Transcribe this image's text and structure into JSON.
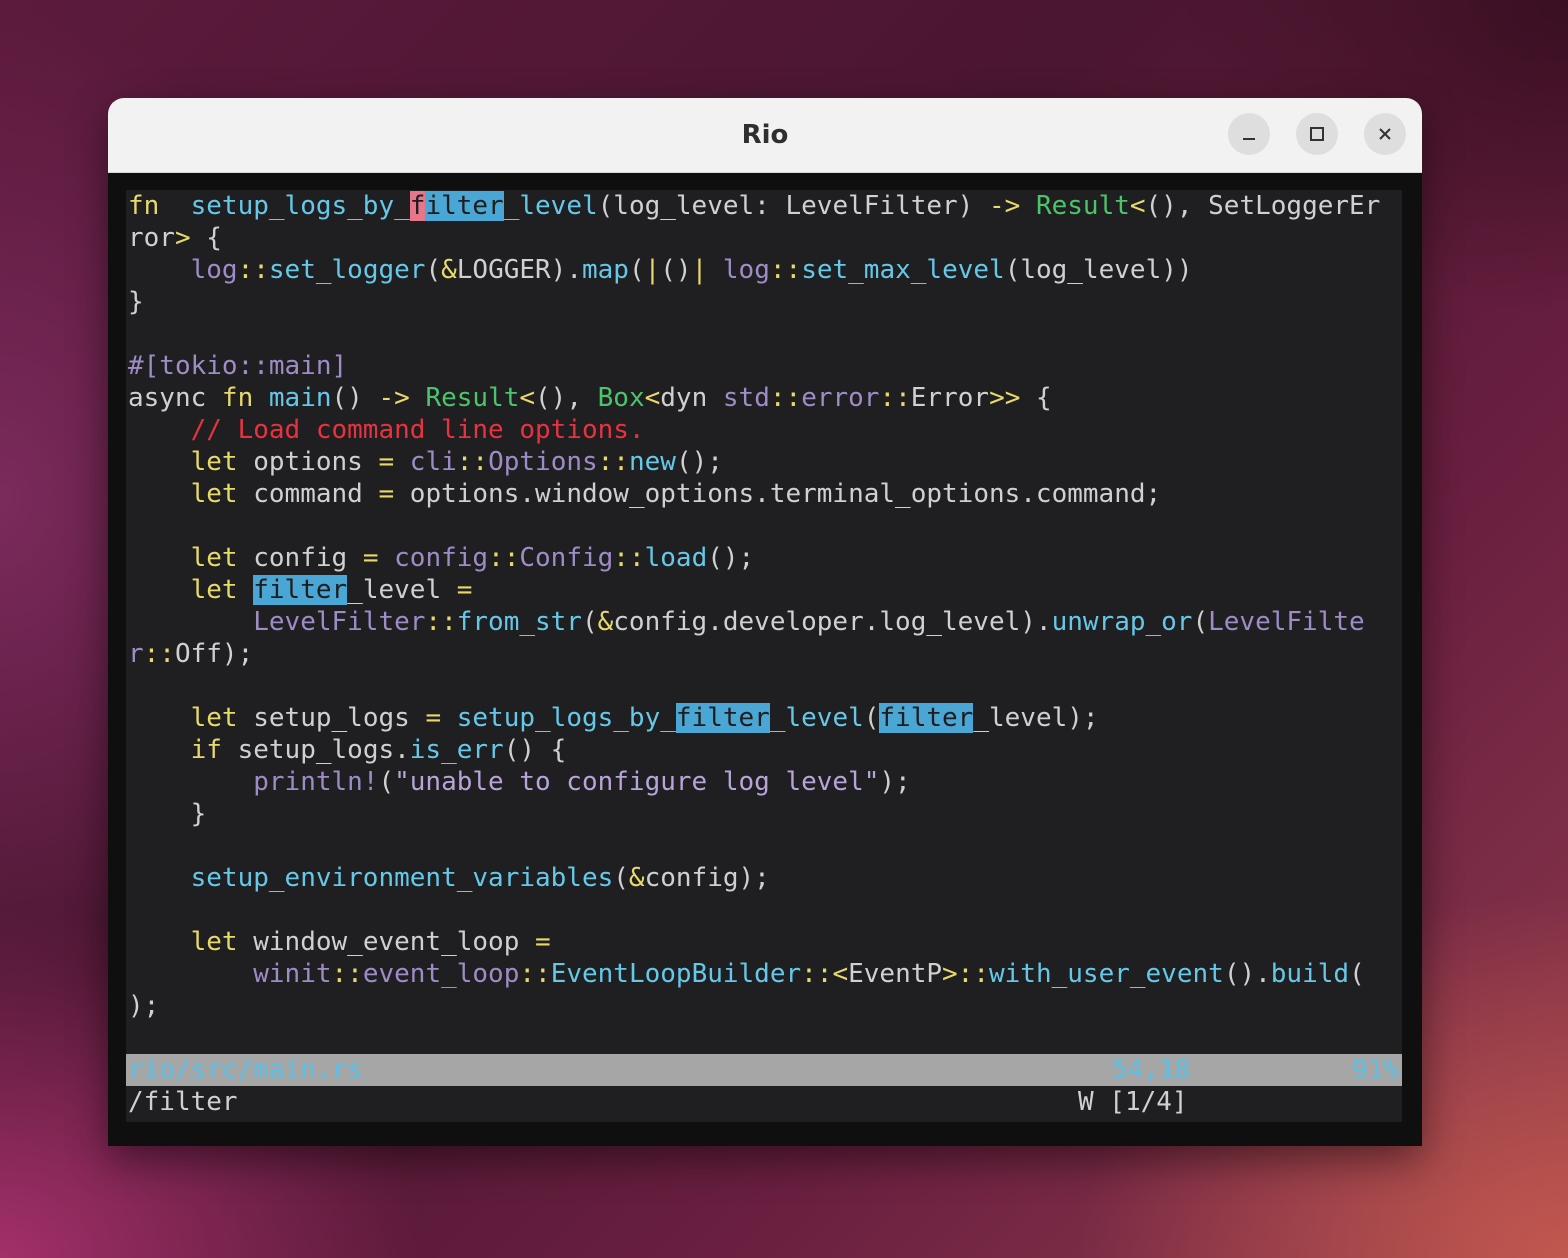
{
  "window": {
    "title": "Rio"
  },
  "controls": {
    "minimize": "–",
    "maximize": "□",
    "close": "×"
  },
  "editor": {
    "lines": [
      [
        [
          "k",
          "fn"
        ],
        [
          "",
          "  "
        ],
        [
          "f",
          "setup_logs_by_"
        ],
        [
          "cur",
          "f"
        ],
        [
          "hl",
          "ilter"
        ],
        [
          "f",
          "_level"
        ],
        [
          "",
          "(log_level: LevelFilter) "
        ],
        [
          "k",
          "->"
        ],
        [
          "",
          " "
        ],
        [
          "t",
          "Result"
        ],
        [
          "k",
          "<"
        ],
        [
          "",
          "(), SetLoggerEr"
        ]
      ],
      [
        [
          "",
          "ror"
        ],
        [
          "k",
          ">"
        ],
        [
          "",
          " {"
        ]
      ],
      [
        [
          "",
          "    "
        ],
        [
          "p",
          "log"
        ],
        [
          "k",
          "::"
        ],
        [
          "f",
          "set_logger"
        ],
        [
          "",
          "("
        ],
        [
          "k",
          "&"
        ],
        [
          "",
          "LOGGER)."
        ],
        [
          "f",
          "map"
        ],
        [
          "",
          "("
        ],
        [
          "k",
          "|"
        ],
        [
          "",
          "()"
        ],
        [
          "k",
          "|"
        ],
        [
          "",
          " "
        ],
        [
          "p",
          "log"
        ],
        [
          "k",
          "::"
        ],
        [
          "f",
          "set_max_level"
        ],
        [
          "",
          "(log_level))"
        ]
      ],
      [
        [
          "",
          "}"
        ]
      ],
      [
        [
          "",
          ""
        ]
      ],
      [
        [
          "p",
          "#[tokio::main]"
        ]
      ],
      [
        [
          "",
          "async "
        ],
        [
          "k",
          "fn"
        ],
        [
          "",
          " "
        ],
        [
          "f",
          "main"
        ],
        [
          "",
          "() "
        ],
        [
          "k",
          "->"
        ],
        [
          "",
          " "
        ],
        [
          "t",
          "Result"
        ],
        [
          "k",
          "<"
        ],
        [
          "",
          "(), "
        ],
        [
          "t",
          "Box"
        ],
        [
          "k",
          "<"
        ],
        [
          "",
          "dyn "
        ],
        [
          "p",
          "std"
        ],
        [
          "k",
          "::"
        ],
        [
          "p",
          "error"
        ],
        [
          "k",
          "::"
        ],
        [
          "",
          "Error"
        ],
        [
          "k",
          ">>"
        ],
        [
          "",
          " {"
        ]
      ],
      [
        [
          "",
          "    "
        ],
        [
          "c",
          "// Load command line options."
        ]
      ],
      [
        [
          "",
          "    "
        ],
        [
          "k",
          "let"
        ],
        [
          "",
          " options "
        ],
        [
          "k",
          "="
        ],
        [
          "",
          " "
        ],
        [
          "p",
          "cli"
        ],
        [
          "k",
          "::"
        ],
        [
          "p",
          "Options"
        ],
        [
          "k",
          "::"
        ],
        [
          "f",
          "new"
        ],
        [
          "",
          "();"
        ]
      ],
      [
        [
          "",
          "    "
        ],
        [
          "k",
          "let"
        ],
        [
          "",
          " command "
        ],
        [
          "k",
          "="
        ],
        [
          "",
          " options.window_options.terminal_options.command;"
        ]
      ],
      [
        [
          "",
          ""
        ]
      ],
      [
        [
          "",
          "    "
        ],
        [
          "k",
          "let"
        ],
        [
          "",
          " config "
        ],
        [
          "k",
          "="
        ],
        [
          "",
          " "
        ],
        [
          "p",
          "config"
        ],
        [
          "k",
          "::"
        ],
        [
          "p",
          "Config"
        ],
        [
          "k",
          "::"
        ],
        [
          "f",
          "load"
        ],
        [
          "",
          "();"
        ]
      ],
      [
        [
          "",
          "    "
        ],
        [
          "k",
          "let"
        ],
        [
          "",
          " "
        ],
        [
          "hl",
          "filter"
        ],
        [
          "",
          "_level "
        ],
        [
          "k",
          "="
        ]
      ],
      [
        [
          "",
          "        "
        ],
        [
          "p",
          "LevelFilter"
        ],
        [
          "k",
          "::"
        ],
        [
          "f",
          "from_str"
        ],
        [
          "",
          "("
        ],
        [
          "k",
          "&"
        ],
        [
          "",
          "config.developer.log_level)."
        ],
        [
          "f",
          "unwrap_or"
        ],
        [
          "",
          "("
        ],
        [
          "p",
          "LevelFilte"
        ]
      ],
      [
        [
          "p",
          "r"
        ],
        [
          "k",
          "::"
        ],
        [
          "",
          "Off);"
        ]
      ],
      [
        [
          "",
          ""
        ]
      ],
      [
        [
          "",
          "    "
        ],
        [
          "k",
          "let"
        ],
        [
          "",
          " setup_logs "
        ],
        [
          "k",
          "="
        ],
        [
          "",
          " "
        ],
        [
          "f",
          "setup_logs_by_"
        ],
        [
          "hl",
          "filter"
        ],
        [
          "f",
          "_level"
        ],
        [
          "",
          "("
        ],
        [
          "hl",
          "filter"
        ],
        [
          "",
          "_level);"
        ]
      ],
      [
        [
          "",
          "    "
        ],
        [
          "k",
          "if"
        ],
        [
          "",
          " setup_logs."
        ],
        [
          "f",
          "is_err"
        ],
        [
          "",
          "() {"
        ]
      ],
      [
        [
          "",
          "        "
        ],
        [
          "p",
          "println!"
        ],
        [
          "",
          "("
        ],
        [
          "s",
          "\"unable to configure log level\""
        ],
        [
          "",
          ");"
        ]
      ],
      [
        [
          "",
          "    }"
        ]
      ],
      [
        [
          "",
          ""
        ]
      ],
      [
        [
          "",
          "    "
        ],
        [
          "f",
          "setup_environment_variables"
        ],
        [
          "",
          "("
        ],
        [
          "k",
          "&"
        ],
        [
          "",
          "config);"
        ]
      ],
      [
        [
          "",
          ""
        ]
      ],
      [
        [
          "",
          "    "
        ],
        [
          "k",
          "let"
        ],
        [
          "",
          " window_event_loop "
        ],
        [
          "k",
          "="
        ]
      ],
      [
        [
          "",
          "        "
        ],
        [
          "p",
          "winit"
        ],
        [
          "k",
          "::"
        ],
        [
          "p",
          "event_loop"
        ],
        [
          "k",
          "::"
        ],
        [
          "f",
          "EventLoopBuilder"
        ],
        [
          "k",
          "::<"
        ],
        [
          "",
          "EventP"
        ],
        [
          "k",
          ">::"
        ],
        [
          "f",
          "with_user_event"
        ],
        [
          "",
          "()."
        ],
        [
          "f",
          "build"
        ],
        [
          "",
          "("
        ]
      ],
      [
        [
          "",
          ");"
        ]
      ]
    ]
  },
  "statusline": {
    "file": "rio/src/main.rs",
    "position": "54,18",
    "percent": "91%"
  },
  "cmdline": {
    "command": "/filter",
    "search_count": "W [1/4]"
  }
}
